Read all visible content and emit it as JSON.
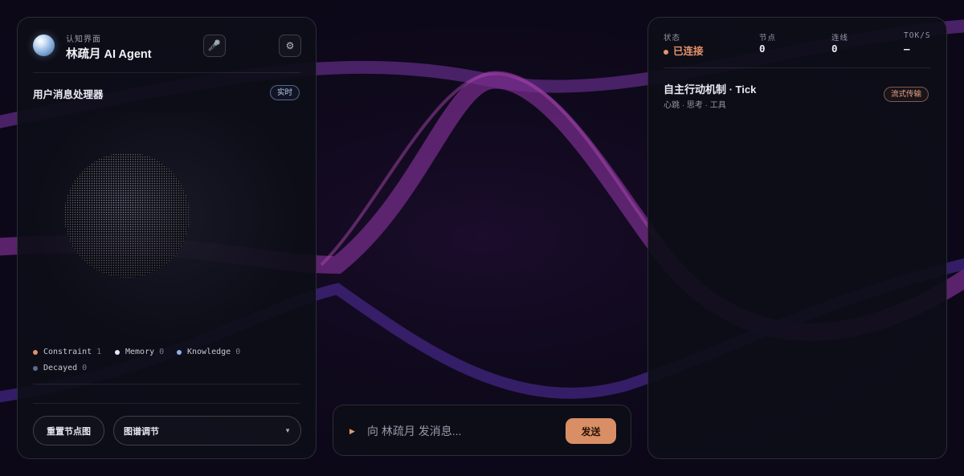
{
  "colors": {
    "accent": "#d98e65",
    "constraint": "#e0906a",
    "memory": "#dfe6ff",
    "knowledge": "#8fb1e6",
    "decayed": "#5e6b8a",
    "status_connected": "#e8946a"
  },
  "left_panel": {
    "subtitle": "认知界面",
    "title": "林疏月 AI Agent",
    "mic_icon": "microphone-icon",
    "settings_icon": "gear-icon",
    "mic_glyph": "🎤",
    "settings_glyph": "⚙",
    "section_title": "用户消息处理器",
    "live_badge": "实时",
    "legend": [
      {
        "label": "Constraint",
        "count": "1",
        "color": "#e0906a"
      },
      {
        "label": "Memory",
        "count": "0",
        "color": "#dfe6ff"
      },
      {
        "label": "Knowledge",
        "count": "0",
        "color": "#8fb1e6"
      },
      {
        "label": "Decayed",
        "count": "0",
        "color": "#5e6b8a"
      }
    ],
    "reset_button": "重置节点图",
    "graph_adjust": "图谱调节"
  },
  "composer": {
    "placeholder": "向 林疏月 发消息...",
    "send_label": "发送"
  },
  "right_panel": {
    "stats": [
      {
        "label": "状态",
        "value": "已连接"
      },
      {
        "label": "节点",
        "value": "0"
      },
      {
        "label": "连线",
        "value": "0"
      },
      {
        "label": "TOK/S",
        "value": "—"
      }
    ],
    "section_title": "自主行动机制 · Tick",
    "section_subtitle": "心跳 · 思考 · 工具",
    "stream_badge": "流式传输"
  }
}
